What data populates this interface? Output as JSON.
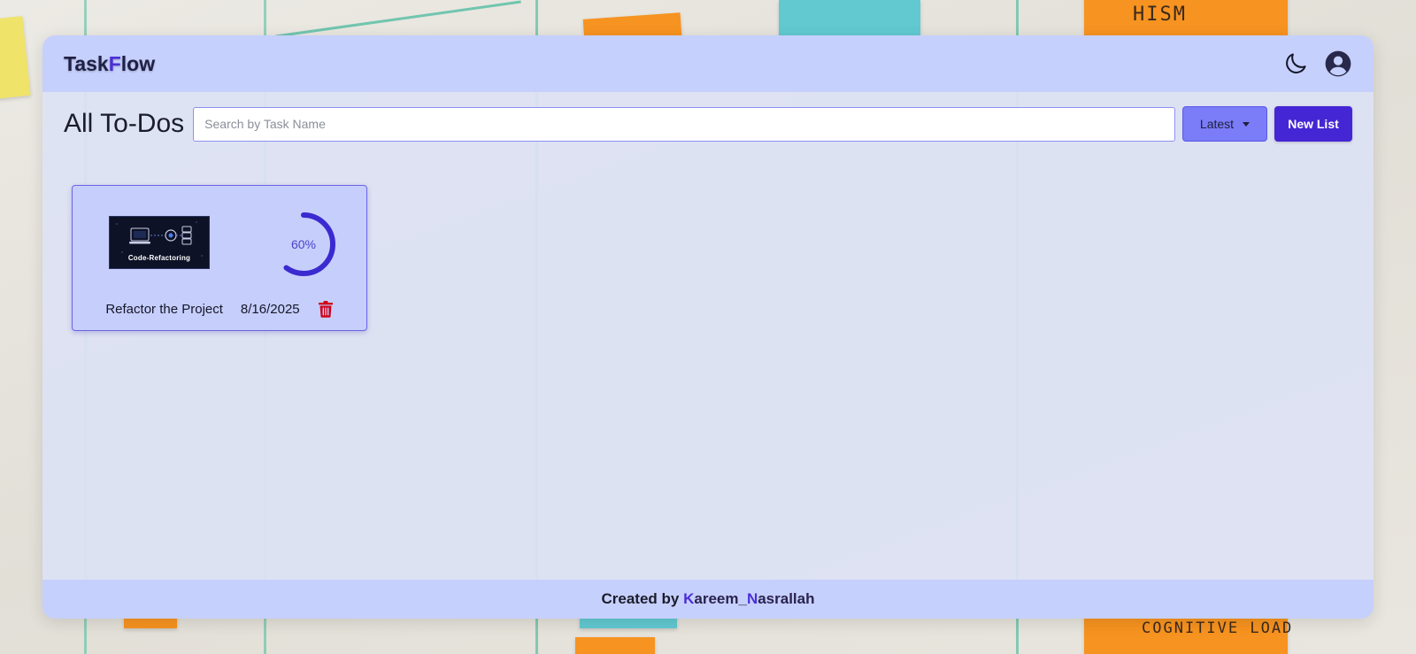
{
  "app": {
    "brand_part1": "Task",
    "brand_accent": "F",
    "brand_part2": "low"
  },
  "navbar": {
    "theme_toggle_icon": "moon-icon",
    "account_icon": "user-circle-icon"
  },
  "toolbar": {
    "title": "All To-Dos",
    "search_placeholder": "Search by Task Name",
    "search_value": "",
    "sort_label": "Latest",
    "new_list_label": "New List"
  },
  "tasks": [
    {
      "name": "Refactor the Project",
      "date": "8/16/2025",
      "progress": 60,
      "progress_label": "60%",
      "thumbnail_text": "Code-Refactoring",
      "delete_icon": "trash-icon"
    }
  ],
  "footer": {
    "prefix": "Created by ",
    "author_k": "K",
    "author_mid": "areem_",
    "author_n": "N",
    "author_end": "asrallah"
  },
  "colors": {
    "accent": "#4526d4",
    "navbar_bg": "#c6d0fc",
    "card_bg": "#c6cffb",
    "delete_red": "#d0021b"
  }
}
